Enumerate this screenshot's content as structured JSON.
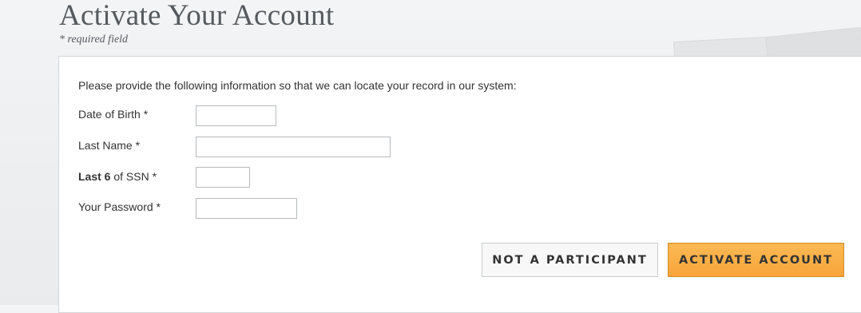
{
  "page": {
    "title": "Activate Your Account",
    "required_note": "* required field"
  },
  "form": {
    "intro": "Please provide the following information so that we can locate your record in our system:",
    "fields": {
      "dob": {
        "label": "Date of Birth *",
        "value": ""
      },
      "last_name": {
        "label": "Last Name *",
        "value": ""
      },
      "ssn": {
        "label_bold": "Last 6",
        "label_rest": " of SSN *",
        "value": ""
      },
      "password": {
        "label": "Your Password *",
        "value": ""
      }
    }
  },
  "actions": {
    "not_participant": "NOT A PARTICIPANT",
    "activate": "ACTIVATE ACCOUNT"
  },
  "colors": {
    "primary_button": "#f8a53a",
    "title_text": "#555a5e"
  }
}
